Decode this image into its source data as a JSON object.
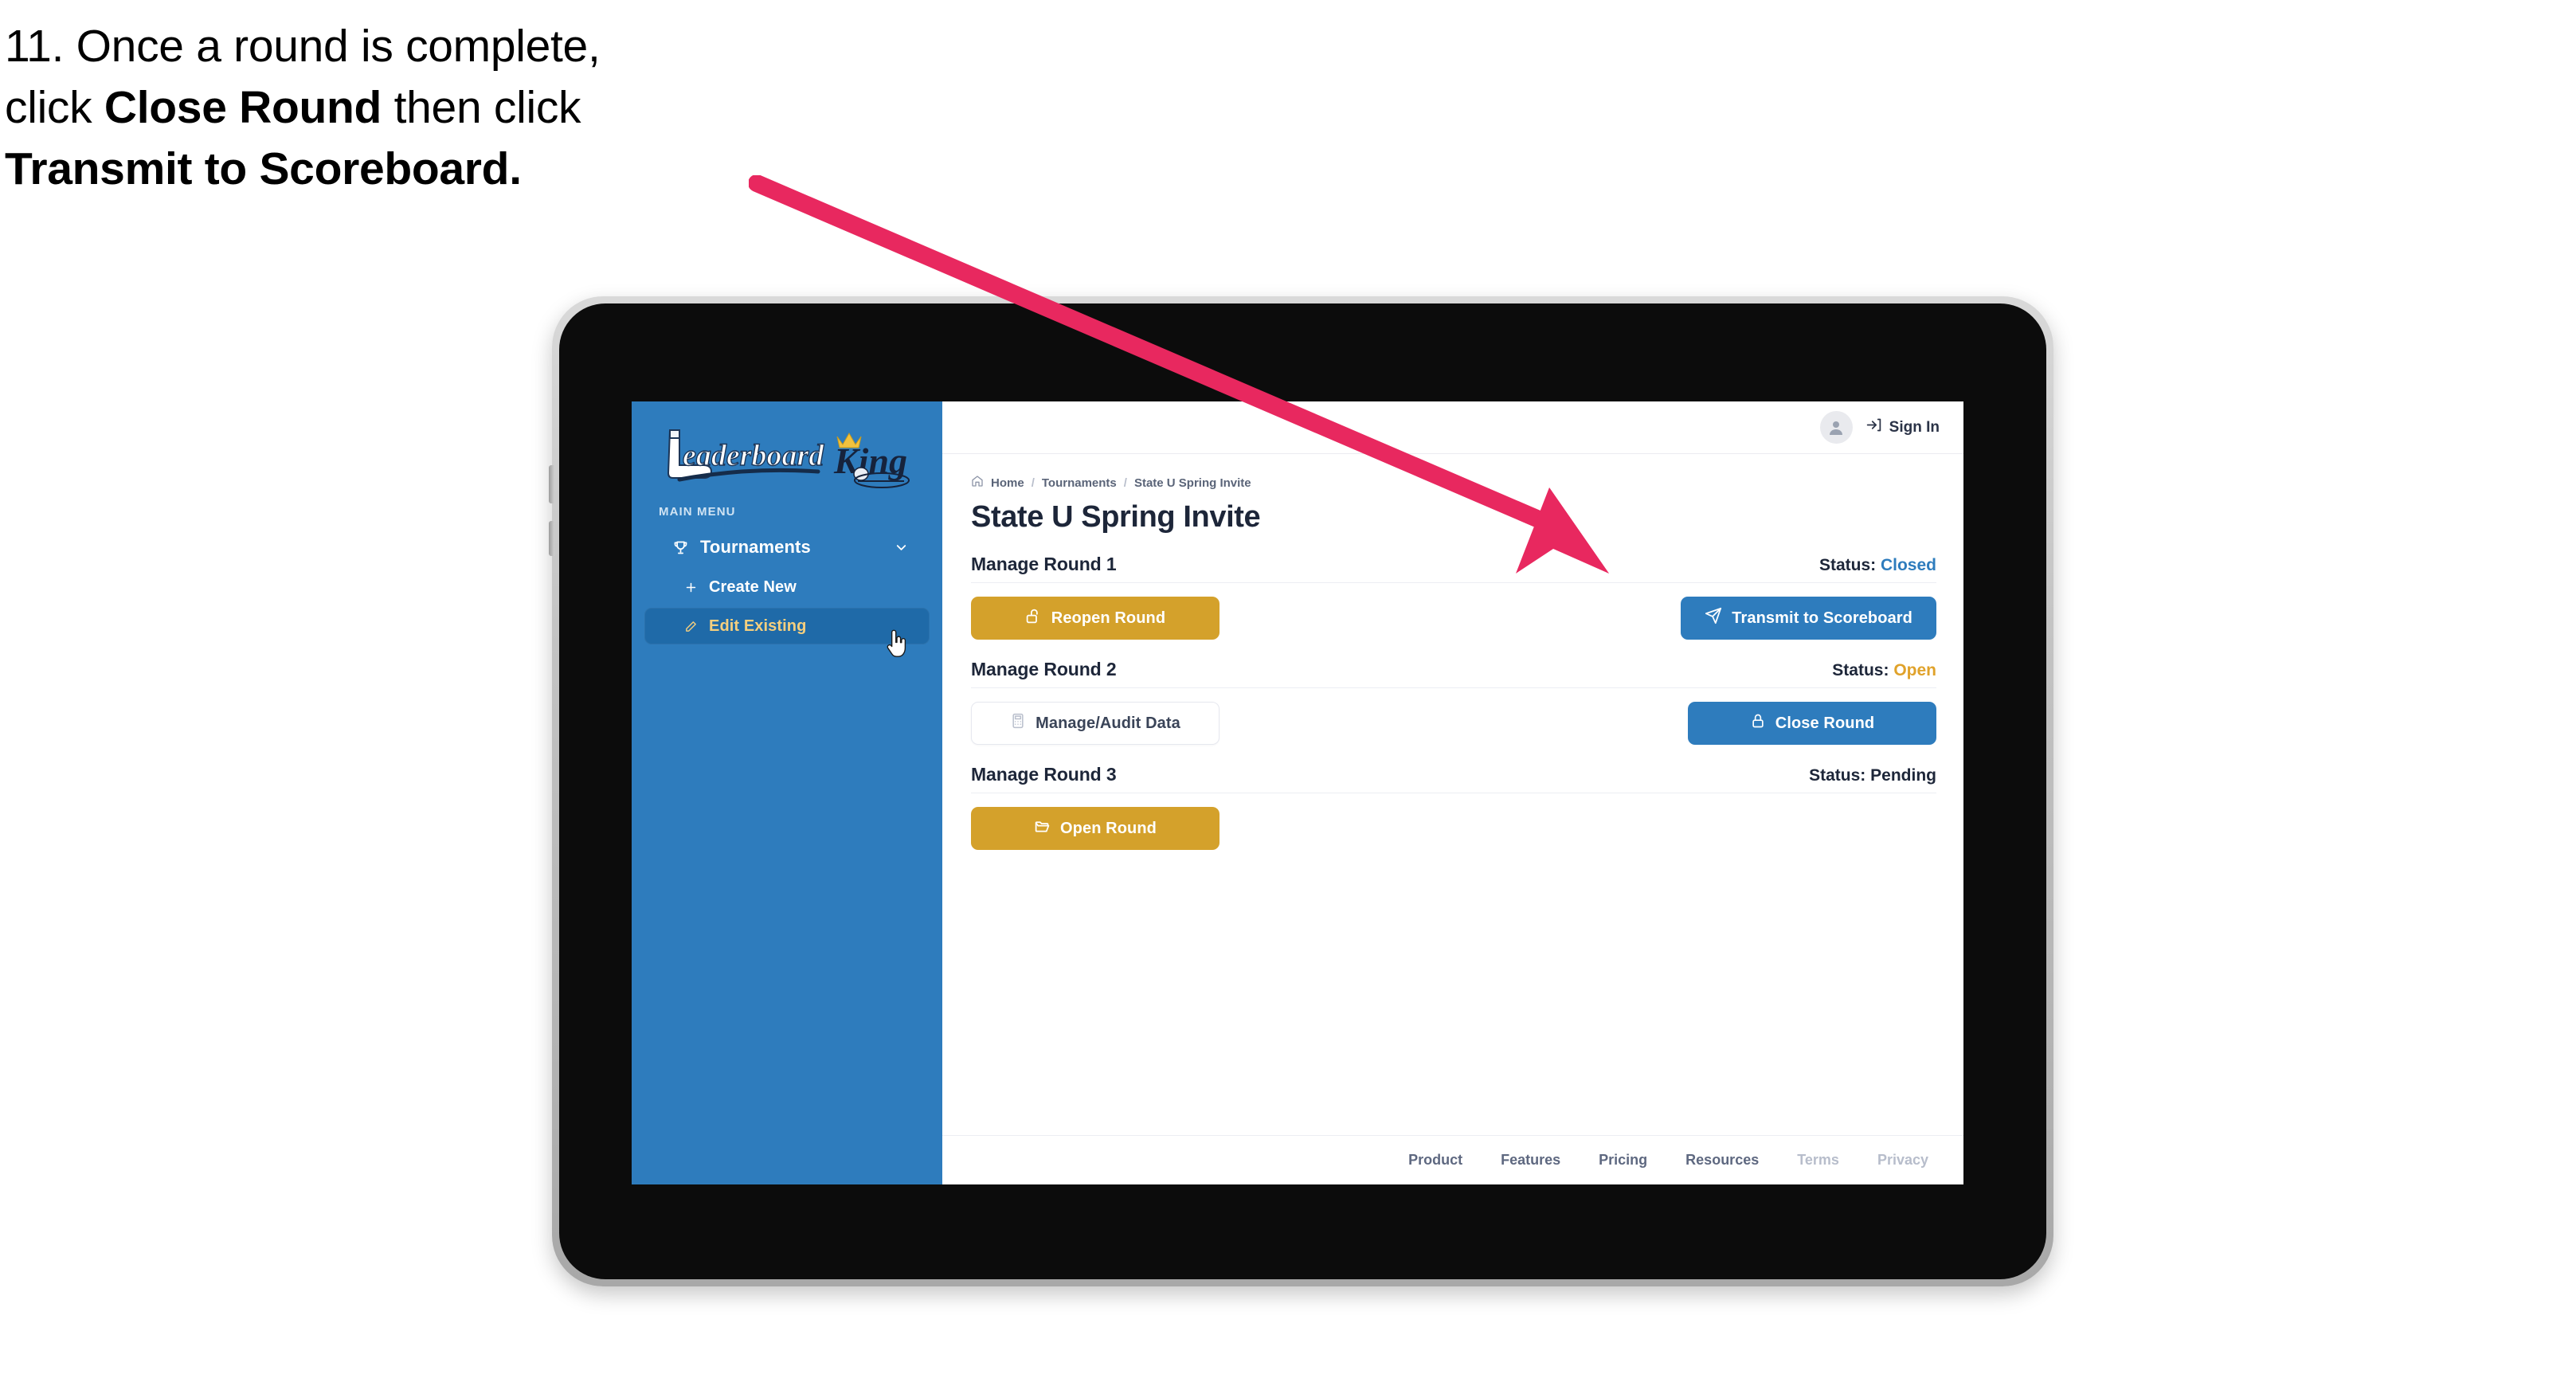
{
  "caption": {
    "line1_prefix": "11. Once a round is complete,",
    "line2_prefix": "click ",
    "line2_bold": "Close Round",
    "line2_suffix": " then click",
    "line3_bold": "Transmit to Scoreboard."
  },
  "annotation": {
    "arrow_color": "#E8285F"
  },
  "sidebar": {
    "logo_word1": "Leaderboard",
    "logo_word2": "King",
    "menu_label": "MAIN MENU",
    "items": [
      {
        "label": "Tournaments",
        "icon": "trophy-icon",
        "chevron": "chevron-down-icon"
      }
    ],
    "subitems": [
      {
        "label": "Create New",
        "icon": "plus-icon",
        "active": false
      },
      {
        "label": "Edit Existing",
        "icon": "edit-pencil-icon",
        "active": true
      }
    ],
    "bg_color": "#2E7CBD",
    "active_bg_color": "#1F6AA8",
    "active_text_color": "#F5CF7E"
  },
  "topbar": {
    "avatar_icon": "user-avatar-icon",
    "signin_icon": "login-arrow-icon",
    "signin_label": "Sign In"
  },
  "breadcrumb": {
    "home_icon": "home-icon",
    "items": [
      "Home",
      "Tournaments",
      "State U Spring Invite"
    ],
    "separator": "/"
  },
  "page": {
    "title": "State U Spring Invite"
  },
  "rounds": [
    {
      "title": "Manage Round 1",
      "status_label": "Status:",
      "status_value": "Closed",
      "status_color": "#2E7CBD",
      "left_button": {
        "label": "Reopen Round",
        "icon": "unlock-icon",
        "style": "gold"
      },
      "right_button": {
        "label": "Transmit to Scoreboard",
        "icon": "paper-plane-icon",
        "style": "blue"
      }
    },
    {
      "title": "Manage Round 2",
      "status_label": "Status:",
      "status_value": "Open",
      "status_color": "#E0A22A",
      "left_button": {
        "label": "Manage/Audit Data",
        "icon": "calculator-icon",
        "style": "ghost"
      },
      "right_button": {
        "label": "Close Round",
        "icon": "lock-icon",
        "style": "blue"
      }
    },
    {
      "title": "Manage Round 3",
      "status_label": "Status:",
      "status_value": "Pending",
      "status_color": "#1d2639",
      "left_button": {
        "label": "Open Round",
        "icon": "folder-open-icon",
        "style": "gold"
      },
      "right_button": null
    }
  ],
  "footer": {
    "links": [
      {
        "label": "Product",
        "muted": false
      },
      {
        "label": "Features",
        "muted": false
      },
      {
        "label": "Pricing",
        "muted": false
      },
      {
        "label": "Resources",
        "muted": false
      },
      {
        "label": "Terms",
        "muted": true
      },
      {
        "label": "Privacy",
        "muted": true
      }
    ]
  }
}
